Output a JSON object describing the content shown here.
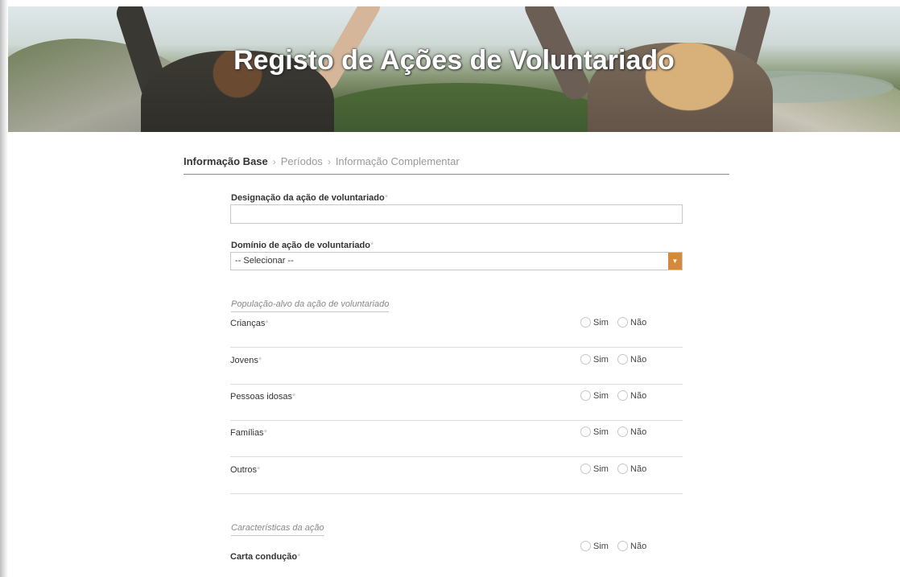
{
  "banner": {
    "title": "Registo de Ações de Voluntariado"
  },
  "steps": [
    {
      "label": "Informação Base"
    },
    {
      "label": "Períodos"
    },
    {
      "label": "Informação Complementar"
    }
  ],
  "form": {
    "designacao_label": "Designação da ação de voluntariado",
    "designacao_value": "",
    "dominio_label": "Domínio de ação de voluntariado",
    "dominio_selected": "-- Selecionar --",
    "required_mark": "*"
  },
  "populacao": {
    "section_title": "População-alvo da ação de voluntariado",
    "rows": [
      {
        "label": "Crianças"
      },
      {
        "label": "Jovens"
      },
      {
        "label": "Pessoas idosas"
      },
      {
        "label": "Famílias"
      },
      {
        "label": "Outros"
      }
    ]
  },
  "caracteristicas": {
    "section_title": "Características da ação",
    "rows": [
      {
        "label": "Carta condução"
      }
    ]
  },
  "radio_labels": {
    "yes": "Sim",
    "no": "Não"
  },
  "colors": {
    "select_arrow": "#d7893a",
    "required": "#c0c0c0"
  }
}
